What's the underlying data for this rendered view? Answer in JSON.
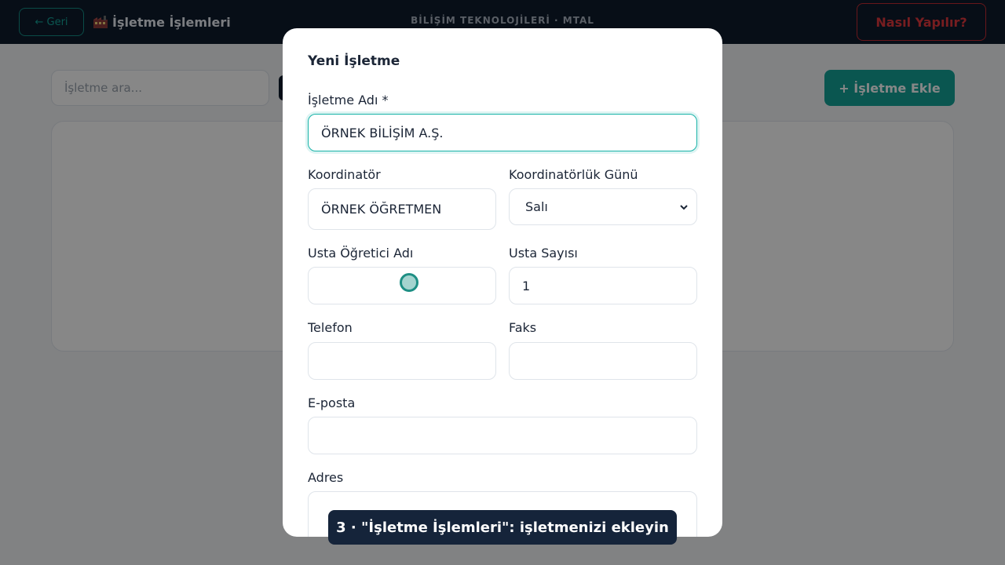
{
  "topbar": {
    "back_label": "← Geri",
    "app_title": "İşletme İşlemleri",
    "center_title": "BİLİŞİM TEKNOLOJİLERİ · MTAL",
    "help_label": "Nasıl Yapılır?"
  },
  "page": {
    "search_placeholder": "İşletme ara...",
    "add_button_label": "+ İşletme Ekle"
  },
  "modal": {
    "title": "Yeni İşletme",
    "fields": {
      "isletme_adi": {
        "label": "İşletme Adı *",
        "value": "ÖRNEK BİLİŞİM A.Ş."
      },
      "koordinator": {
        "label": "Koordinatör",
        "value": "ÖRNEK ÖĞRETMEN"
      },
      "koordinatorluk_gunu": {
        "label": "Koordinatörlük Günü",
        "value": "Salı"
      },
      "usta_ogretici_adi": {
        "label": "Usta Öğretici Adı",
        "value": ""
      },
      "usta_sayisi": {
        "label": "Usta Sayısı",
        "value": "1"
      },
      "telefon": {
        "label": "Telefon",
        "value": ""
      },
      "faks": {
        "label": "Faks",
        "value": ""
      },
      "eposta": {
        "label": "E-posta",
        "value": ""
      },
      "adres": {
        "label": "Adres",
        "value": ""
      }
    }
  },
  "caption": "3 · \"İşletme İşlemleri\": işletmenizi ekleyin",
  "colors": {
    "accent": "#14a398",
    "topbar_bg": "#0f1b2c",
    "help_red": "#e0383e",
    "caption_bg": "#15243a"
  },
  "icons": {
    "app_icon": "factory-icon",
    "select_icon": "chevron-down-icon"
  }
}
